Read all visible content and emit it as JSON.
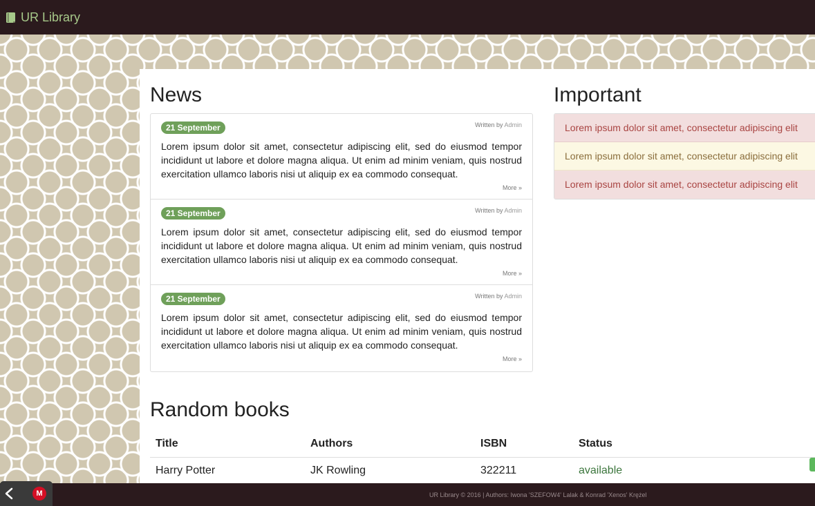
{
  "navbar": {
    "brand": "UR Library",
    "brand_icon": "book-icon",
    "brand_color": "#a7c98a",
    "background": "#2b1a1d"
  },
  "news": {
    "title": "News",
    "items": [
      {
        "date": "21 September",
        "written_by_label": "Written by",
        "author": "Admin",
        "body": "Lorem ipsum dolor sit amet, consectetur adipiscing elit, sed do eiusmod tempor incididunt ut labore et dolore magna aliqua. Ut enim ad minim veniam, quis nostrud exercitation ullamco laboris nisi ut aliquip ex ea commodo consequat.",
        "more": "More »"
      },
      {
        "date": "21 September",
        "written_by_label": "Written by",
        "author": "Admin",
        "body": "Lorem ipsum dolor sit amet, consectetur adipiscing elit, sed do eiusmod tempor incididunt ut labore et dolore magna aliqua. Ut enim ad minim veniam, quis nostrud exercitation ullamco laboris nisi ut aliquip ex ea commodo consequat.",
        "more": "More »"
      },
      {
        "date": "21 September",
        "written_by_label": "Written by",
        "author": "Admin",
        "body": "Lorem ipsum dolor sit amet, consectetur adipiscing elit, sed do eiusmod tempor incididunt ut labore et dolore magna aliqua. Ut enim ad minim veniam, quis nostrud exercitation ullamco laboris nisi ut aliquip ex ea commodo consequat.",
        "more": "More »"
      }
    ]
  },
  "important": {
    "title": "Important",
    "alerts": [
      {
        "type": "danger",
        "text": "Lorem ipsum dolor sit amet, consectetur adipiscing elit"
      },
      {
        "type": "warning",
        "text": "Lorem ipsum dolor sit amet, consectetur adipiscing elit"
      },
      {
        "type": "danger",
        "text": "Lorem ipsum dolor sit amet, consectetur adipiscing elit"
      }
    ]
  },
  "books": {
    "title": "Random books",
    "columns": [
      "Title",
      "Authors",
      "ISBN",
      "Status"
    ],
    "rows": [
      {
        "title": "Harry Potter",
        "authors": "JK Rowling",
        "isbn": "322211",
        "status": "available"
      }
    ]
  },
  "footer": {
    "text": "UR Library © 2016 | Authors: Iwona 'SZEFOW4' Lalak & Konrad 'Xenos' Krężel"
  },
  "taskbar": {
    "back_icon": "chevron-left-icon",
    "app_icon": "m-app-icon",
    "app_letter": "M"
  }
}
